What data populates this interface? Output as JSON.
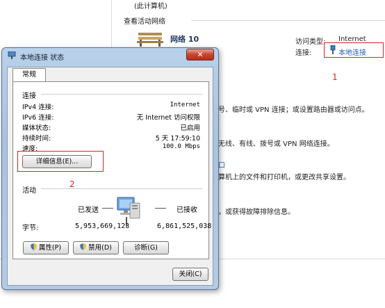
{
  "background": {
    "top_text": "(此计算机)",
    "section_title": "查看活动网络",
    "network_name": "网络  10",
    "access_type_label": "访问类型:",
    "access_type_value": "Internet",
    "connection_label": "连接:",
    "connection_value": "本地连接",
    "text_1": "号、临时或 VPN 连接；或设置路由器或访问点。",
    "text_2": "无线、有线、拨号或 VPN 网络连接。",
    "text_3_link": "口",
    "text_4": "算机上的文件和打印机，或更改共享设置。",
    "text_5": "，或获得故障排除信息。"
  },
  "annotations": {
    "num_1": "1",
    "num_2": "2"
  },
  "dialog": {
    "title": "本地连接 状态",
    "close_glyph": "✕",
    "tab_general": "常规",
    "connection_section": "连接",
    "rows": [
      {
        "label": "IPv4 连接:",
        "value": "Internet"
      },
      {
        "label": "IPv6 连接:",
        "value": "无 Internet 访问权限"
      },
      {
        "label": "媒体状态:",
        "value": "已启用"
      },
      {
        "label": "持续时间:",
        "value": "5 天 17:59:10"
      },
      {
        "label": "速度:",
        "value": "100.0 Mbps"
      }
    ],
    "details_button": "详细信息(E)...",
    "activity_section": "活动",
    "sent_label": "已发送",
    "received_label": "已接收",
    "bytes_label": "字节:",
    "bytes_sent": "5,953,669,123",
    "bytes_received": "6,861,525,038",
    "properties_button": "属性(P)",
    "disable_button": "禁用(D)",
    "diagnose_button": "诊断(G)",
    "close_button": "关闭(C)"
  },
  "icons": [
    "network-bench-icon",
    "network-connection-icon",
    "adapter-icon",
    "shield-icon",
    "close-icon",
    "computer-network-icon"
  ],
  "colors": {
    "accent": "#1f5fb8",
    "annotation": "#e02020",
    "titlebar": "#b9d1ea"
  }
}
